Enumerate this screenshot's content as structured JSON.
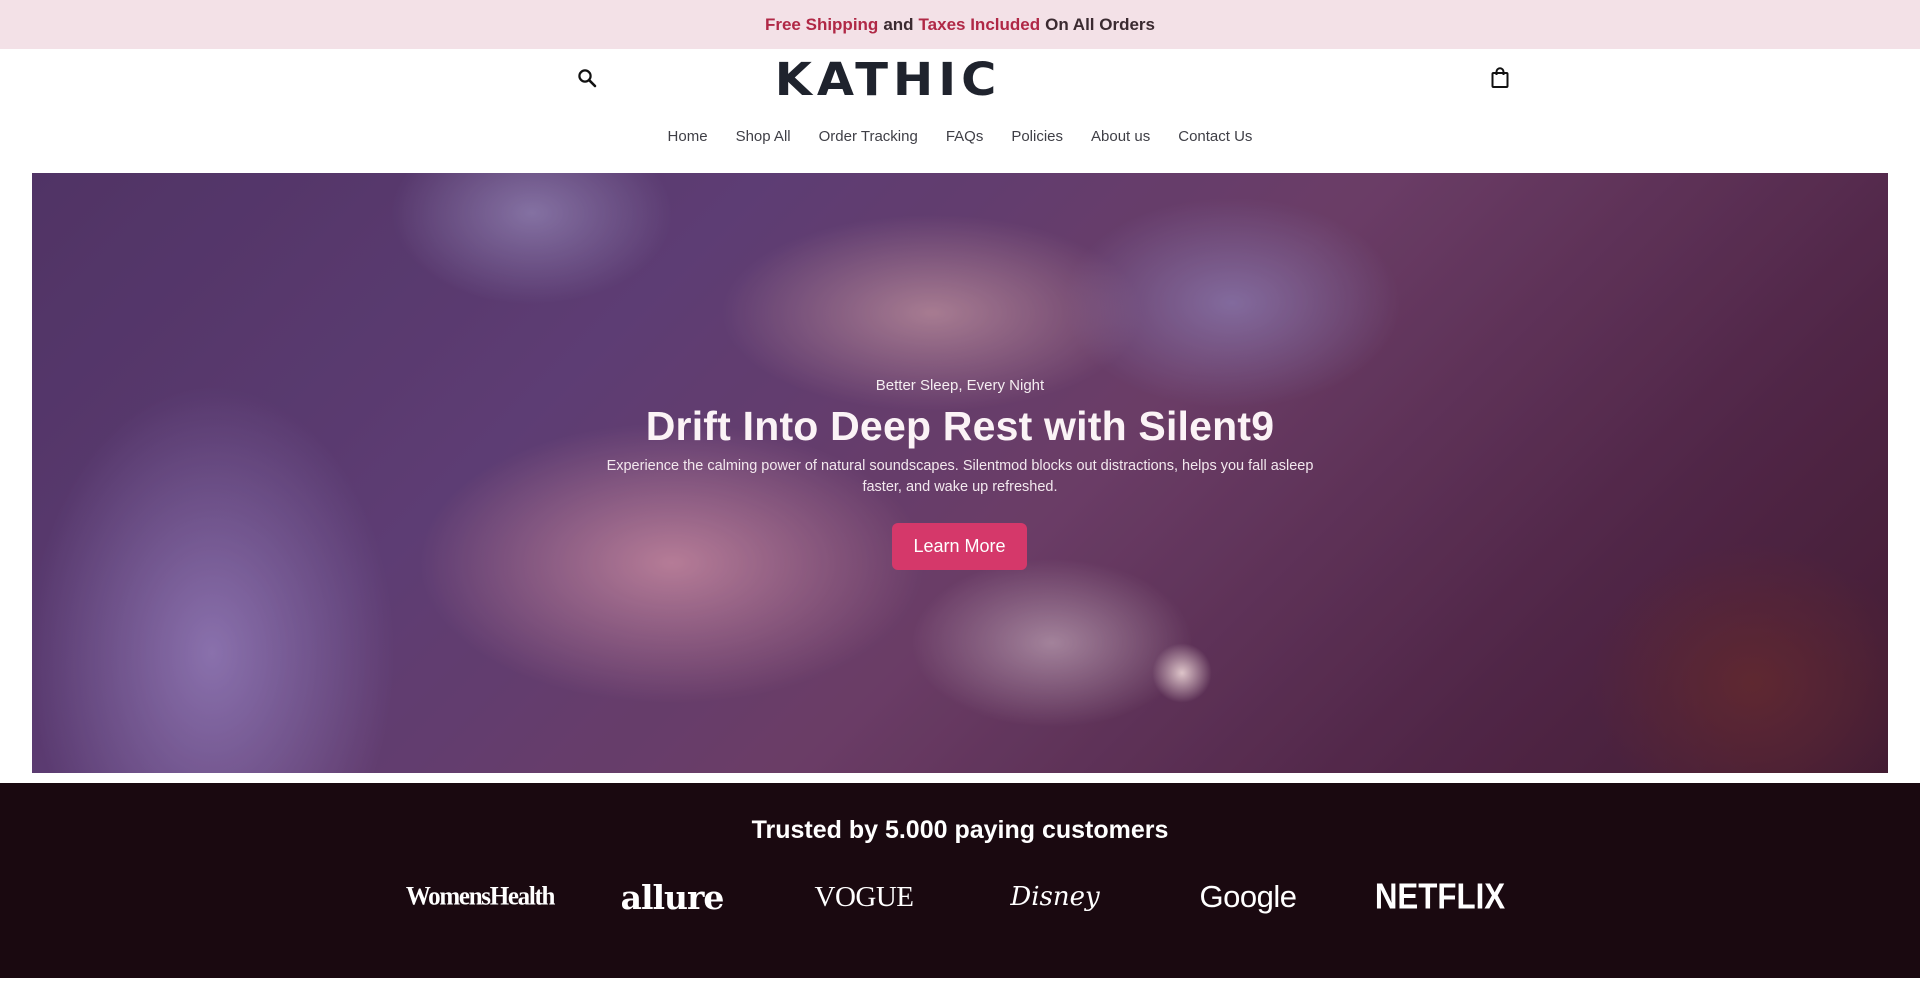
{
  "announcement": {
    "glyph": "",
    "part1": "Free Shipping",
    "part2": "and",
    "part3": "Taxes Included",
    "part4": "On All Orders"
  },
  "header": {
    "logo": "KATHIC",
    "search_icon": "search-icon",
    "cart_icon": "shopping-bag-icon"
  },
  "nav": {
    "items": [
      "Home",
      "Shop All",
      "Order Tracking",
      "FAQs",
      "Policies",
      "About us",
      "Contact Us"
    ]
  },
  "hero": {
    "eyebrow": "Better Sleep, Every Night",
    "title": "Drift Into Deep Rest with Silent9",
    "description": "Experience the calming power of natural soundscapes. Silentmod blocks out distractions, helps you fall asleep faster, and wake up refreshed.",
    "cta": "Learn More"
  },
  "trusted": {
    "title": "Trusted by 5.000 paying customers",
    "logos": [
      "WomensHealth",
      "allure",
      "VOGUE",
      "Disney",
      "Google",
      "NETFLIX"
    ]
  },
  "colors": {
    "announcement_bg": "#f3e1e7",
    "accent_red": "#b02846",
    "cta_bg": "#d5386a",
    "trusted_bg": "#1a0910",
    "logo_text": "#1f232d"
  }
}
